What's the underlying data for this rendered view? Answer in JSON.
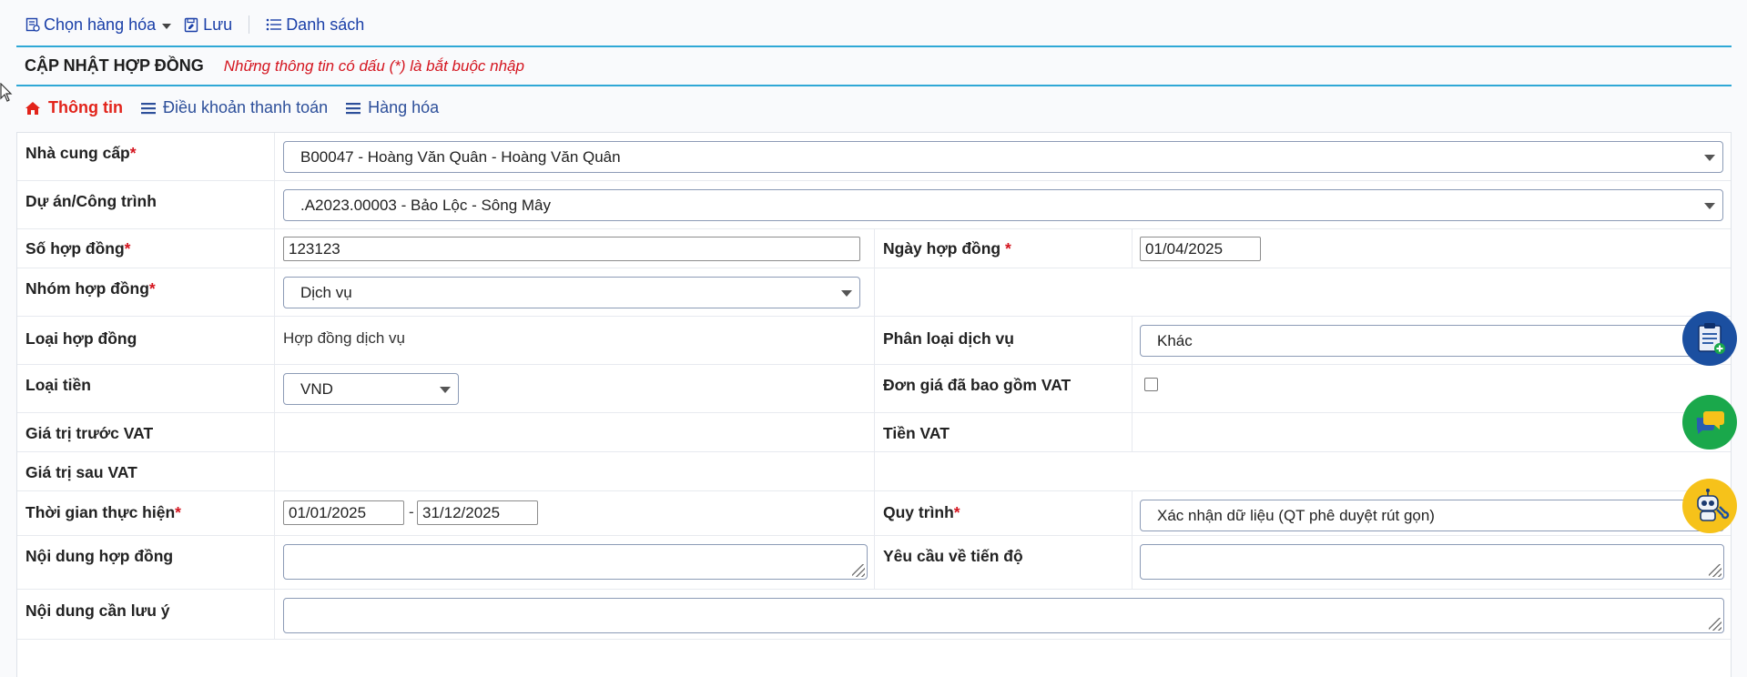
{
  "toolbar": {
    "choose_goods": "Chọn hàng hóa",
    "save": "Lưu",
    "list": "Danh sách"
  },
  "header": {
    "title": "CẬP NHẬT HỢP ĐỒNG",
    "required_note": "Những thông tin có dấu (*) là bắt buộc nhập"
  },
  "tabs": [
    {
      "label": "Thông tin",
      "icon": "home-icon",
      "active": true
    },
    {
      "label": "Điều khoản thanh toán",
      "icon": "list-icon",
      "active": false
    },
    {
      "label": "Hàng hóa",
      "icon": "list-icon",
      "active": false
    }
  ],
  "form": {
    "required_mark": "*",
    "supplier": {
      "label": "Nhà cung cấp",
      "value": "B00047 - Hoàng Văn Quân - Hoàng Văn Quân"
    },
    "project": {
      "label": "Dự án/Công trình",
      "value": ".A2023.00003 - Bảo Lộc - Sông Mây"
    },
    "contract_no": {
      "label": "Số hợp đồng",
      "value": "123123"
    },
    "contract_date": {
      "label": "Ngày hợp đồng",
      "value": "01/04/2025"
    },
    "contract_group": {
      "label": "Nhóm hợp đồng",
      "value": "Dịch vụ"
    },
    "contract_type": {
      "label": "Loại hợp đồng",
      "value": "Hợp đồng dịch vụ"
    },
    "service_class": {
      "label": "Phân loại dịch vụ",
      "value": "Khác"
    },
    "currency": {
      "label": "Loại tiền",
      "value": "VND"
    },
    "vat_included": {
      "label": "Đơn giá đã bao gồm VAT",
      "checked": false
    },
    "value_before_vat": {
      "label": "Giá trị trước VAT",
      "value": ""
    },
    "vat_amount": {
      "label": "Tiền VAT",
      "value": ""
    },
    "value_after_vat": {
      "label": "Giá trị sau VAT",
      "value": ""
    },
    "period": {
      "label": "Thời gian thực hiện",
      "from": "01/01/2025",
      "separator": "-",
      "to": "31/12/2025"
    },
    "workflow": {
      "label": "Quy trình",
      "value": "Xác nhận dữ liệu (QT phê duyệt rút gọn)"
    },
    "contract_content": {
      "label": "Nội dung hợp đồng",
      "value": ""
    },
    "progress_requirements": {
      "label": "Yêu cầu về tiến độ",
      "value": ""
    },
    "notes": {
      "label": "Nội dung cần lưu ý",
      "value": ""
    }
  },
  "floating_buttons": [
    {
      "name": "clipboard-add-icon",
      "color": "#1b4fa0"
    },
    {
      "name": "chat-icon",
      "color": "#1aa84b"
    },
    {
      "name": "robot-support-icon",
      "color": "#f6c21a"
    }
  ]
}
